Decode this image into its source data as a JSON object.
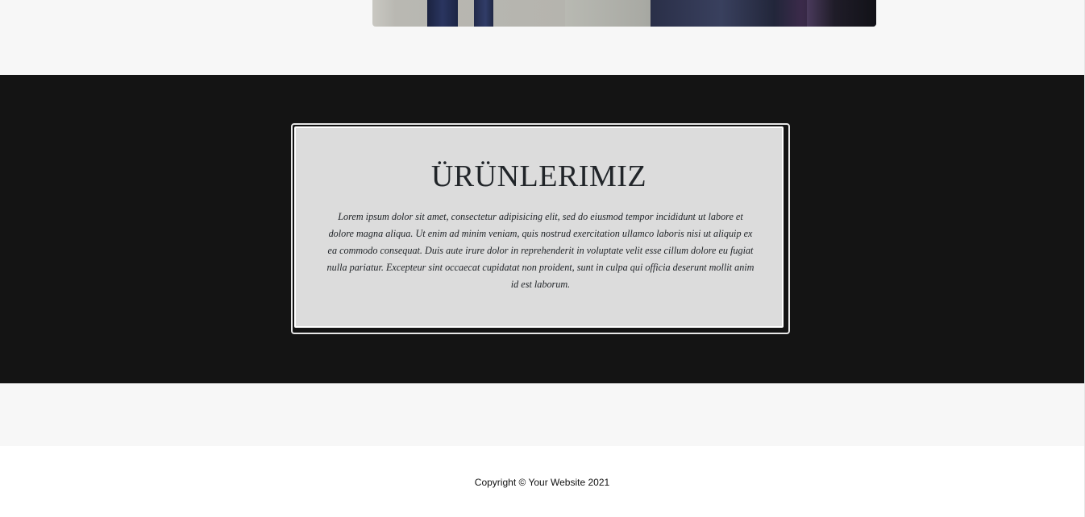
{
  "products_section": {
    "title": "ÜRÜNLERIMIZ",
    "body": "Lorem ipsum dolor sit amet, consectetur adipisicing elit, sed do eiusmod tempor incididunt ut labore et dolore magna aliqua. Ut enim ad minim veniam, quis nostrud exercitation ullamco laboris nisi ut aliquip ex ea commodo consequat. Duis aute irure dolor in reprehenderit in voluptate velit esse cillum dolore eu fugiat nulla pariatur. Excepteur sint occaecat cupidatat non proident, sunt in culpa qui officia deserunt mollit anim id est laborum."
  },
  "footer": {
    "copyright": "Copyright © Your Website 2021"
  },
  "colors": {
    "dark_section_bg": "#141414",
    "card_bg": "#dcdcdc",
    "light_band_bg": "#f7f7f7",
    "text": "#212529"
  }
}
